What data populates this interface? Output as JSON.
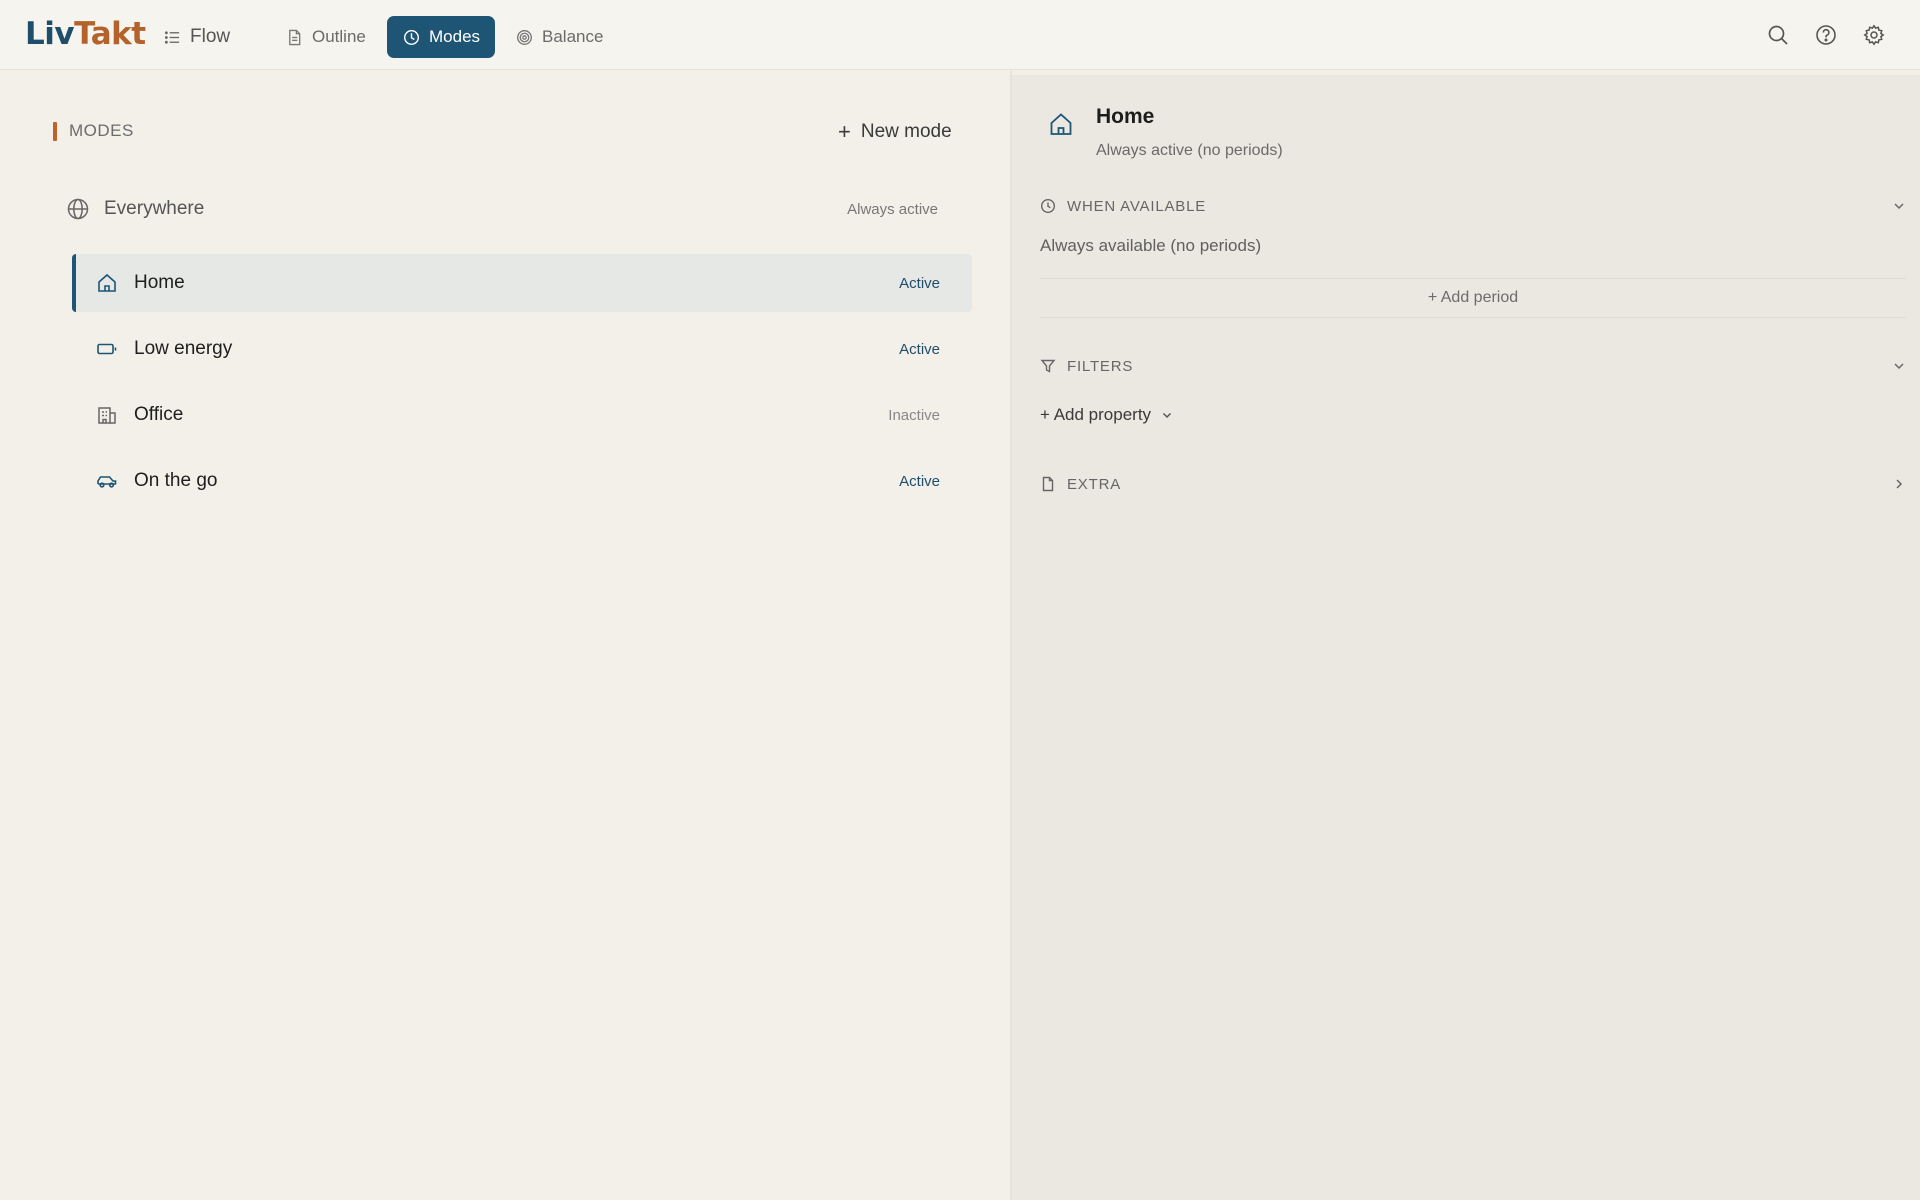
{
  "app": {
    "logo_part1": "Liv",
    "logo_part2": "Takt",
    "accent_color": "#1e5574",
    "brand_orange": "#c0602a"
  },
  "nav": {
    "tabs": [
      {
        "label": "Flow",
        "icon": "list-icon",
        "active": false
      },
      {
        "label": "Outline",
        "icon": "document-icon",
        "active": false
      },
      {
        "label": "Modes",
        "icon": "clock-icon",
        "active": true
      },
      {
        "label": "Balance",
        "icon": "target-icon",
        "active": false
      }
    ],
    "right_icons": [
      "search-icon",
      "help-icon",
      "gear-icon"
    ]
  },
  "modes_panel": {
    "title": "MODES",
    "new_mode_label": "New mode",
    "everywhere": {
      "label": "Everywhere",
      "status": "Always active",
      "icon": "globe-icon"
    },
    "items": [
      {
        "label": "Home",
        "status": "Active",
        "icon": "home-icon",
        "selected": true
      },
      {
        "label": "Low energy",
        "status": "Active",
        "icon": "battery-icon",
        "selected": false
      },
      {
        "label": "Office",
        "status": "Inactive",
        "icon": "building-icon",
        "selected": false
      },
      {
        "label": "On the go",
        "status": "Active",
        "icon": "car-icon",
        "selected": false
      }
    ]
  },
  "detail": {
    "title": "Home",
    "subtitle": "Always active (no periods)",
    "when_available": {
      "heading": "WHEN AVAILABLE",
      "text": "Always available (no periods)",
      "add_period_label": "+ Add period",
      "expanded": true
    },
    "filters": {
      "heading": "FILTERS",
      "add_property_label": "+ Add property",
      "expanded": true
    },
    "extra": {
      "heading": "EXTRA",
      "expanded": false
    }
  }
}
